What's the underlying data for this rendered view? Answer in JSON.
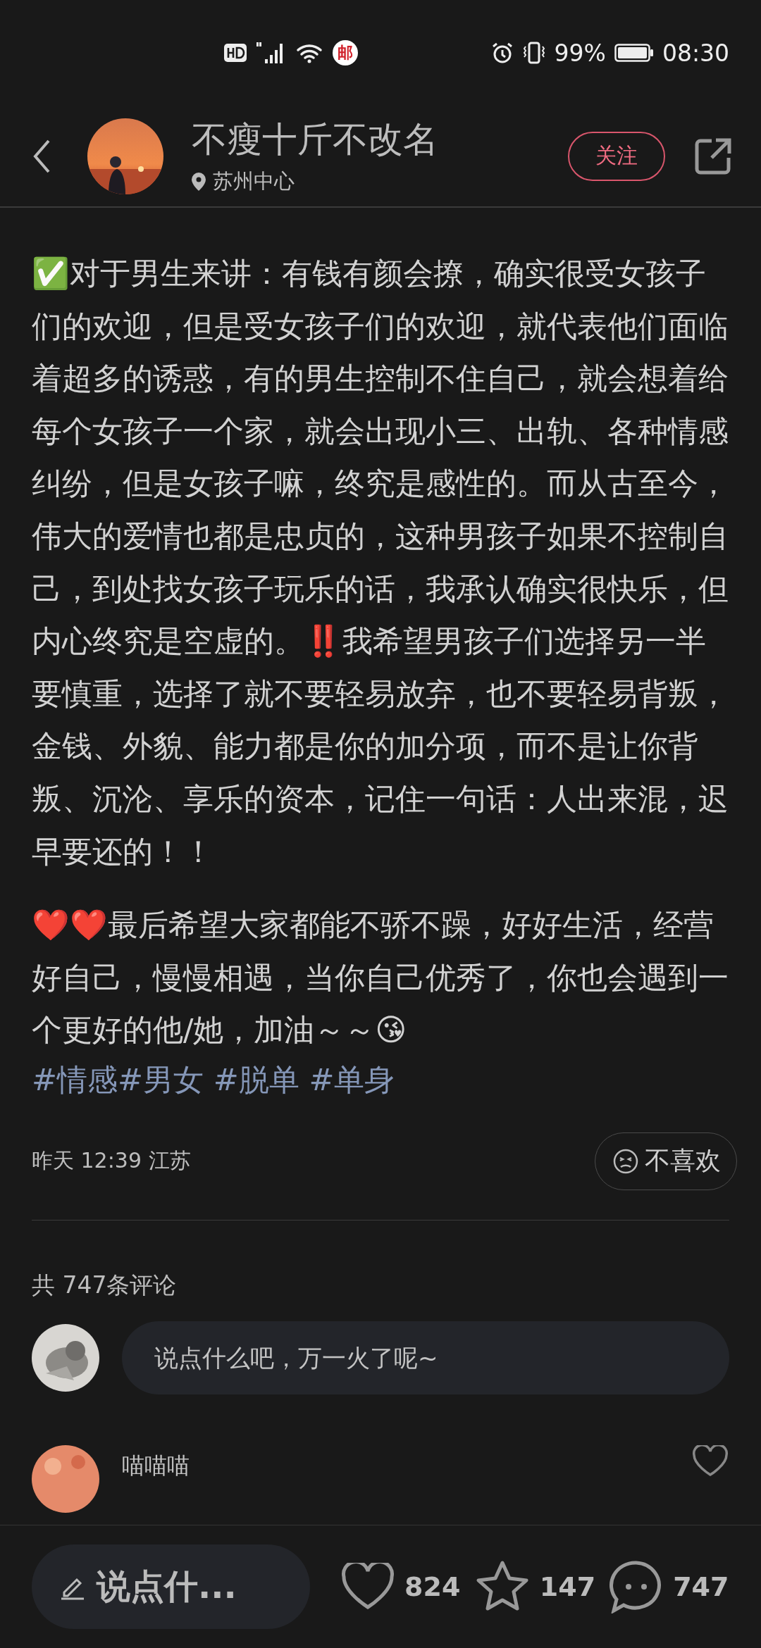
{
  "status_bar": {
    "notification_badge": "邮",
    "battery": "99%",
    "time": "08:30"
  },
  "header": {
    "author": "不瘦十斤不改名",
    "location": "苏州中心",
    "follow_button": "关注"
  },
  "note": {
    "paragraphs": [
      "✅对于男生来讲：有钱有颜会撩，确实很受女孩子们的欢迎，但是受女孩子们的欢迎，就代表他们面临着超多的诱惑，有的男生控制不住自己，就会想着给每个女孩子一个家，就会出现小三、出轨、各种情感纠纷，但是女孩子嘛，终究是感性的。而从古至今，伟大的爱情也都是忠贞的，这种男孩子如果不控制自己，到处找女孩子玩乐的话，我承认确实很快乐，但内心终究是空虚的。‼️我希望男孩子们选择另一半要慎重，选择了就不要轻易放弃，也不要轻易背叛，金钱、外貌、能力都是你的加分项，而不是让你背叛、沉沦、享乐的资本，记住一句话：人出来混，迟早要还的！！",
      "❤️❤️最后希望大家都能不骄不躁，好好生活，经营好自己，慢慢相遇，当你自己优秀了，你也会遇到一个更好的他/她，加油～～😘"
    ],
    "tags": [
      "#情感",
      "#男女 ",
      "#脱单 ",
      "#单身"
    ],
    "posted": "昨天 12:39 江苏",
    "dislike_button": "不喜欢"
  },
  "comments": {
    "count": "共 747条评论",
    "input": {
      "placeholder": "说点什么吧，万一火了呢~"
    },
    "items": [
      {
        "author": "喵喵喵"
      }
    ]
  },
  "bottom_bar": {
    "input": {
      "placeholder": "说点什..."
    },
    "likes": "824",
    "favorites": "147",
    "comments": "747"
  }
}
